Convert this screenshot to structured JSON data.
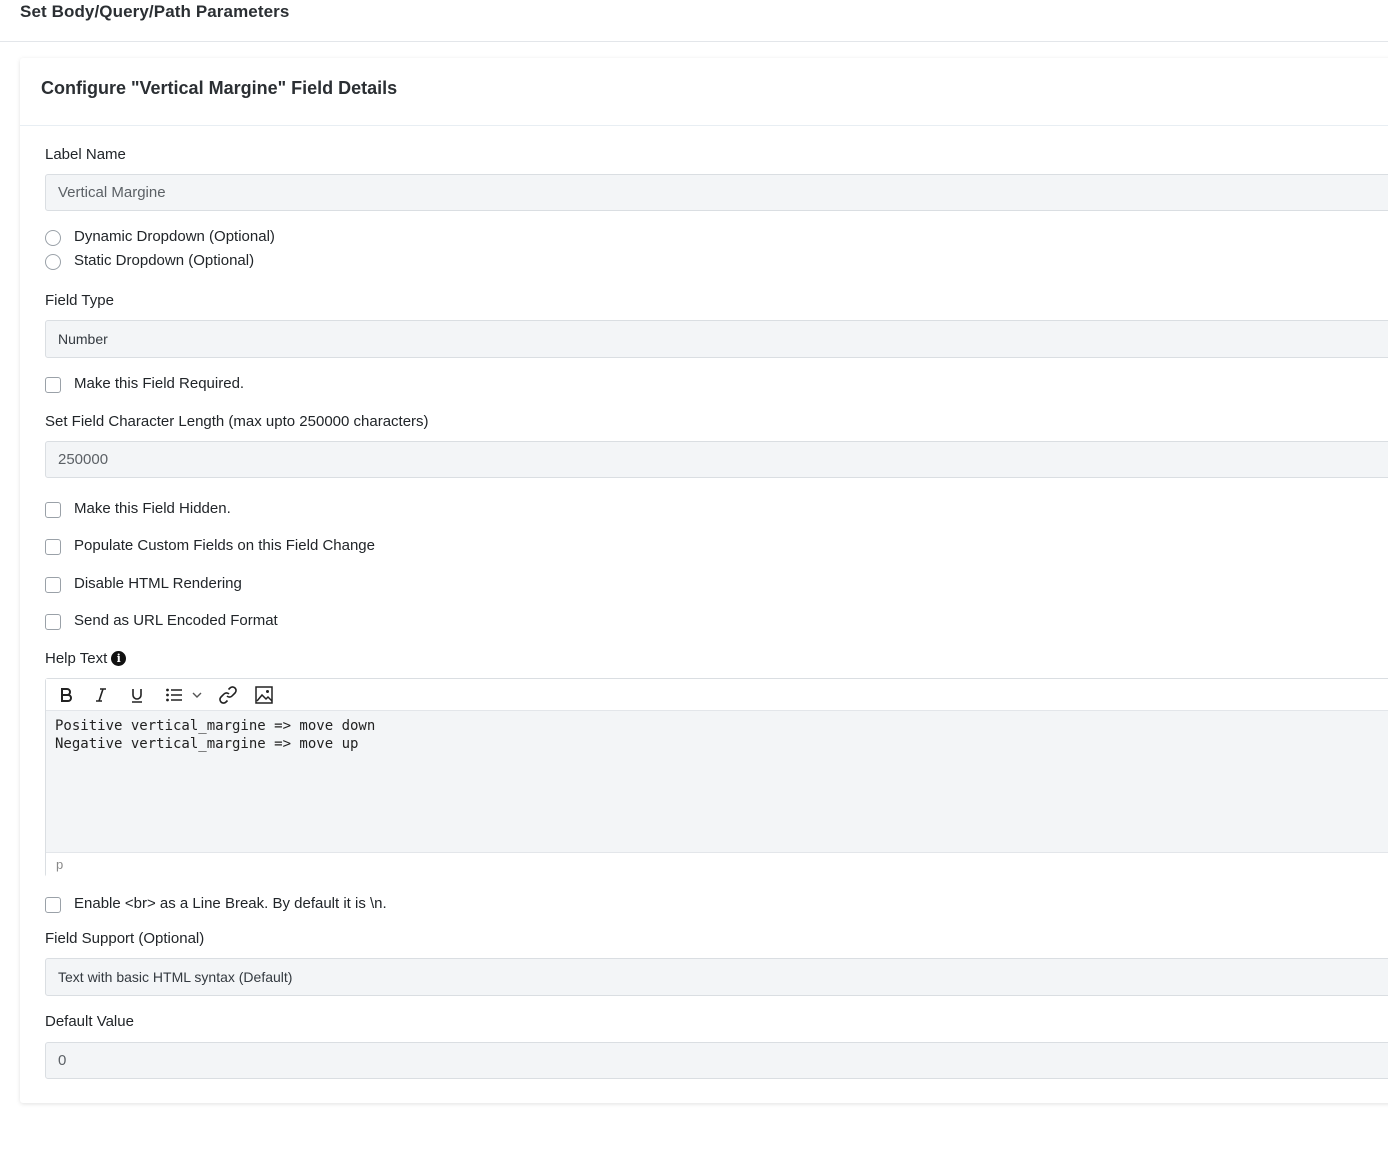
{
  "page": {
    "title": "Set Body/Query/Path Parameters"
  },
  "card": {
    "title": "Configure \"Vertical Margine\" Field Details",
    "label_name": {
      "label": "Label Name",
      "value": "Vertical Margine"
    },
    "dropdown_options": [
      {
        "label": "Dynamic Dropdown (Optional)",
        "selected": false
      },
      {
        "label": "Static Dropdown (Optional)",
        "selected": false
      }
    ],
    "field_type": {
      "label": "Field Type",
      "value": "Number"
    },
    "required": {
      "label": "Make this Field Required.",
      "checked": false
    },
    "char_length": {
      "label": "Set Field Character Length (max upto 250000 characters)",
      "value": "250000"
    },
    "checkboxes": [
      {
        "label": "Make this Field Hidden.",
        "checked": false
      },
      {
        "label": "Populate Custom Fields on this Field Change",
        "checked": false
      },
      {
        "label": "Disable HTML Rendering",
        "checked": false
      },
      {
        "label": "Send as URL Encoded Format",
        "checked": false
      }
    ],
    "help_text": {
      "label": "Help Text",
      "info_glyph": "i",
      "toolbar": [
        "bold-icon",
        "italic-icon",
        "underline-icon",
        "bullet-list-icon",
        "chevron-down-icon",
        "link-icon",
        "image-icon"
      ],
      "lines": [
        "Positive vertical_margine => move down",
        "Negative vertical_margine => move up"
      ],
      "status_path": "p"
    },
    "line_break": {
      "label": "Enable <br> as a Line Break. By default it is \\n.",
      "checked": false
    },
    "field_support": {
      "label": "Field Support (Optional)",
      "value": "Text with basic HTML syntax (Default)"
    },
    "default_value": {
      "label": "Default Value",
      "value": "0"
    }
  }
}
